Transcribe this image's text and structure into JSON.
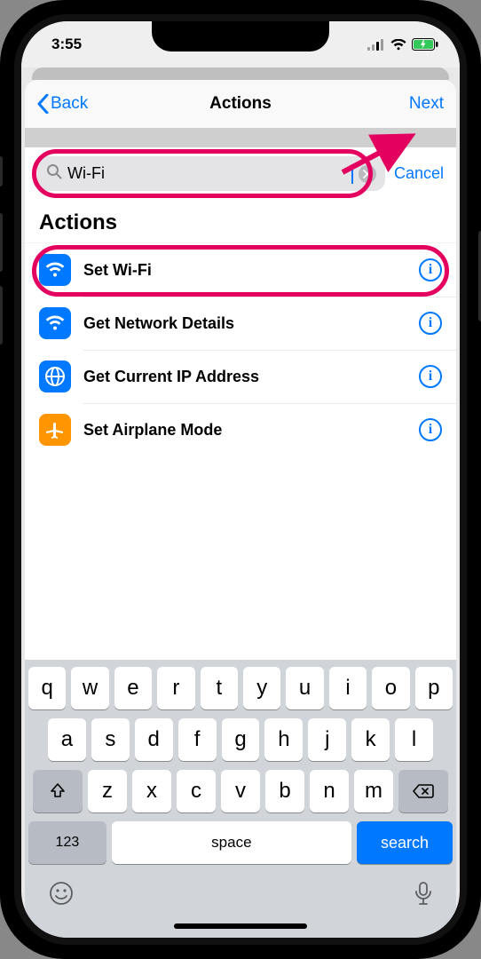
{
  "status": {
    "time": "3:55"
  },
  "nav": {
    "back": "Back",
    "title": "Actions",
    "next": "Next"
  },
  "search": {
    "value": "Wi-Fi",
    "cancel": "Cancel"
  },
  "section_header": "Actions",
  "actions": [
    {
      "label": "Set Wi-Fi",
      "icon": "wifi",
      "bg": "#0078ff"
    },
    {
      "label": "Get Network Details",
      "icon": "wifi",
      "bg": "#0078ff"
    },
    {
      "label": "Get Current IP Address",
      "icon": "globe",
      "bg": "#0078ff"
    },
    {
      "label": "Set Airplane Mode",
      "icon": "airplane",
      "bg": "#ff9500"
    }
  ],
  "keyboard": {
    "row1": [
      "q",
      "w",
      "e",
      "r",
      "t",
      "y",
      "u",
      "i",
      "o",
      "p"
    ],
    "row2": [
      "a",
      "s",
      "d",
      "f",
      "g",
      "h",
      "j",
      "k",
      "l"
    ],
    "row3": [
      "z",
      "x",
      "c",
      "v",
      "b",
      "n",
      "m"
    ],
    "numbers": "123",
    "space": "space",
    "search": "search"
  }
}
